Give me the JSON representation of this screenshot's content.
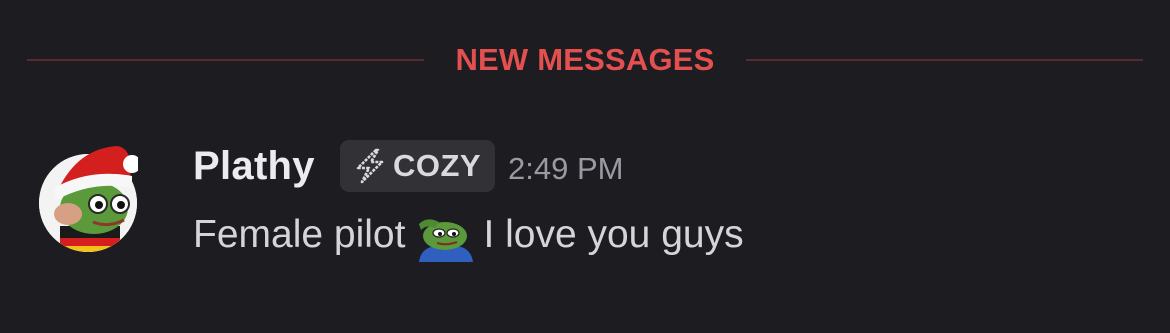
{
  "divider": {
    "label": "NEW MESSAGES"
  },
  "message": {
    "username": "Plathy",
    "role_tag": {
      "icon": "lightning-bolt-icon",
      "label": "COZY"
    },
    "timestamp": "2:49 PM",
    "text_before_emote": "Female pilot",
    "emote": "pepe-salute-emote",
    "text_after_emote": "I love you guys"
  },
  "colors": {
    "background": "#1c1c21",
    "new_messages_red": "#e3504f",
    "username": "#ececf0",
    "timestamp": "#9a9aa3",
    "message_text": "#d4d4da",
    "role_tag_bg": "#313136"
  }
}
